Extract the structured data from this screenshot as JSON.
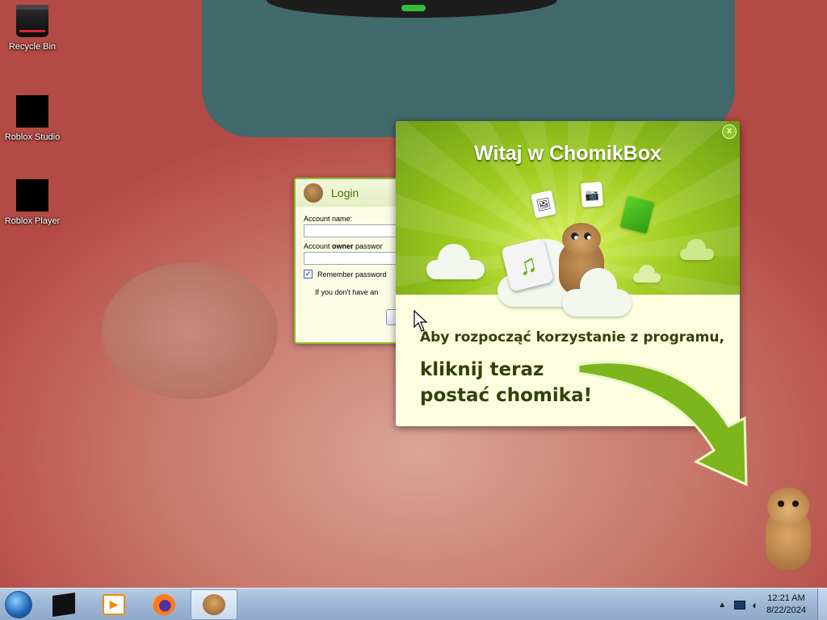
{
  "desktop": {
    "icons": [
      {
        "label": "Recycle Bin",
        "icon": "recycle-bin-icon"
      },
      {
        "label": "Roblox Studio",
        "icon": "roblox-studio-icon"
      },
      {
        "label": "Roblox Player",
        "icon": "roblox-player-icon"
      }
    ]
  },
  "login_window": {
    "title": "Login",
    "account_name_label": "Account name:",
    "account_owner_label_pre": "Account ",
    "account_owner_label_bold": "owner",
    "account_owner_label_post": " passwor",
    "remember_label": "Remember password",
    "remember_checked": true,
    "note": "If you don't have an"
  },
  "welcome_popup": {
    "title": "Witaj w ChomikBox",
    "close_label": "x",
    "message": "Aby rozpocząć korzystanie z programu,",
    "cta_line1": "kliknij teraz",
    "cta_line2": "postać chomika!",
    "accent": "#8ec524"
  },
  "taskbar": {
    "items": [
      {
        "name": "roblox",
        "icon": "roblox-icon"
      },
      {
        "name": "media-player",
        "icon": "media-player-icon"
      },
      {
        "name": "firefox",
        "icon": "firefox-icon"
      },
      {
        "name": "chomikbox",
        "icon": "chomikbox-hamster-icon",
        "active": true
      }
    ],
    "tray_expand": "▲",
    "time": "12:21 AM",
    "date": "8/22/2024"
  }
}
